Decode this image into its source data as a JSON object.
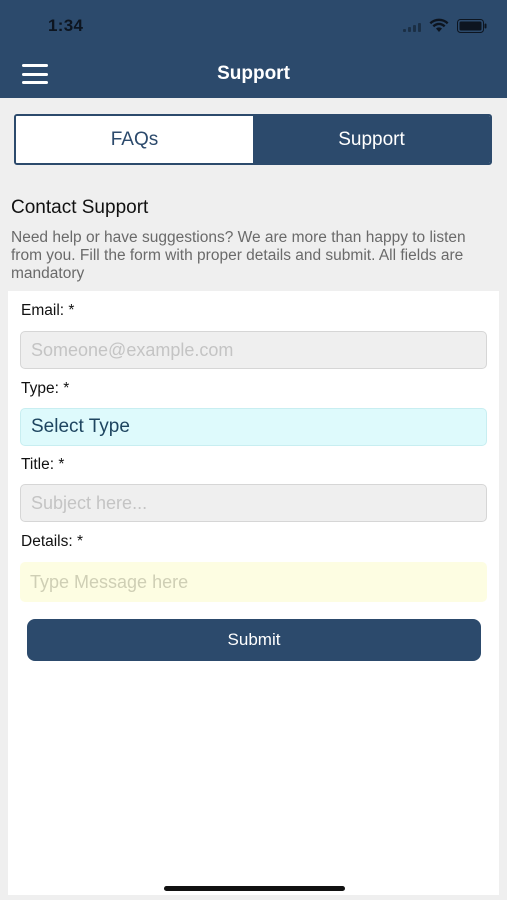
{
  "status_bar": {
    "time": "1:34"
  },
  "nav": {
    "title": "Support",
    "menu_icon": "hamburger-menu-icon"
  },
  "tabs": [
    {
      "label": "FAQs",
      "selected": false
    },
    {
      "label": "Support",
      "selected": true
    }
  ],
  "section": {
    "title": "Contact Support",
    "description": "Need help or have suggestions? We are more than happy to listen from you. Fill the form with proper details and submit. All fields are mandatory"
  },
  "form": {
    "email": {
      "label": "Email: *",
      "placeholder": "Someone@example.com",
      "value": ""
    },
    "type": {
      "label": "Type: *",
      "value": "Select Type"
    },
    "title": {
      "label": "Title: *",
      "placeholder": "Subject here...",
      "value": ""
    },
    "details": {
      "label": "Details: *",
      "placeholder": "Type Message here",
      "value": ""
    },
    "submit_label": "Submit"
  },
  "colors": {
    "brand": "#2c4a6c",
    "background": "#efefef",
    "type_field_bg": "#defafc",
    "details_field_bg": "#fdfde2"
  }
}
